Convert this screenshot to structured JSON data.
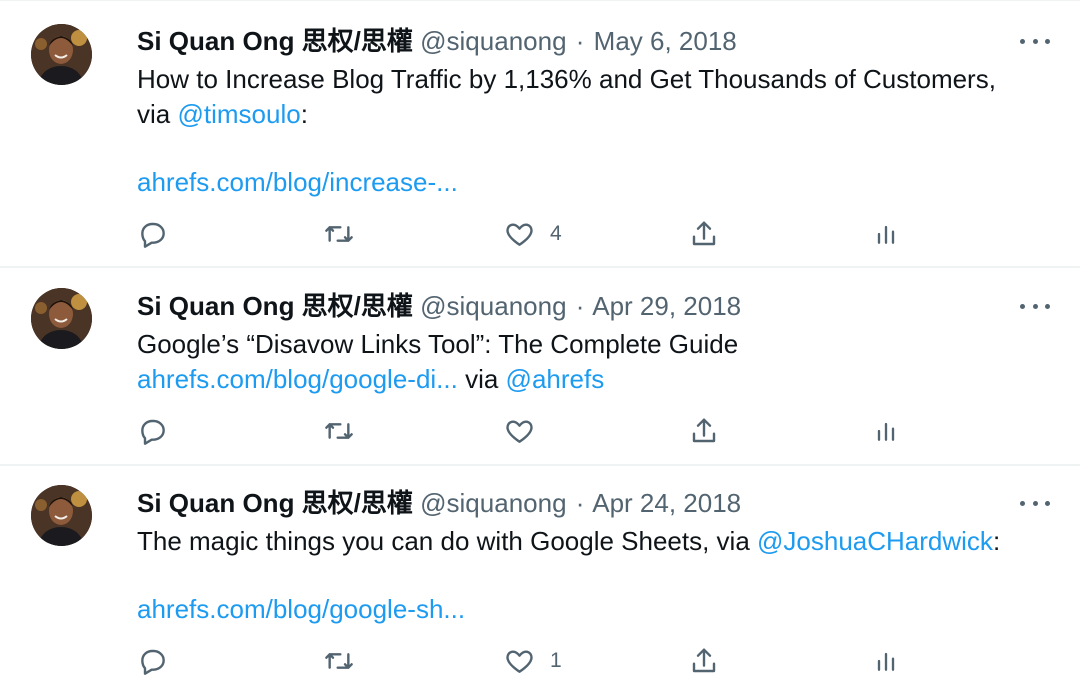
{
  "tweets": [
    {
      "name": "Si Quan Ong 思权/思權",
      "handle": "@siquanong",
      "separator": "·",
      "date": "May 6, 2018",
      "text_line1": "How to Increase Blog Traffic by 1,136% and Get Thousands of Customers,",
      "text_line2_prefix": "via ",
      "mention": "@timsoulo",
      "text_line2_suffix": ":",
      "link": "ahrefs.com/blog/increase-...",
      "like_count": "4"
    },
    {
      "name": "Si Quan Ong 思权/思權",
      "handle": "@siquanong",
      "separator": "·",
      "date": "Apr 29, 2018",
      "text_line1": "Google’s “Disavow Links Tool”: The Complete Guide",
      "link": "ahrefs.com/blog/google-di...",
      "text_middle": " via ",
      "mention": "@ahrefs",
      "like_count": ""
    },
    {
      "name": "Si Quan Ong 思权/思權",
      "handle": "@siquanong",
      "separator": "·",
      "date": "Apr 24, 2018",
      "text_line1_prefix": "The magic things you can do with Google Sheets, via ",
      "mention": "@JoshuaCHardwick",
      "text_line1_suffix": ":",
      "link": "ahrefs.com/blog/google-sh...",
      "like_count": "1"
    }
  ],
  "icons": {
    "reply": "reply-icon",
    "retweet": "retweet-icon",
    "like": "heart-icon",
    "share": "share-icon",
    "analytics": "analytics-icon",
    "more": "more-icon"
  },
  "colors": {
    "text": "#0f1419",
    "secondary": "#536471",
    "link": "#1d9bf0",
    "divider": "#eff3f4"
  }
}
